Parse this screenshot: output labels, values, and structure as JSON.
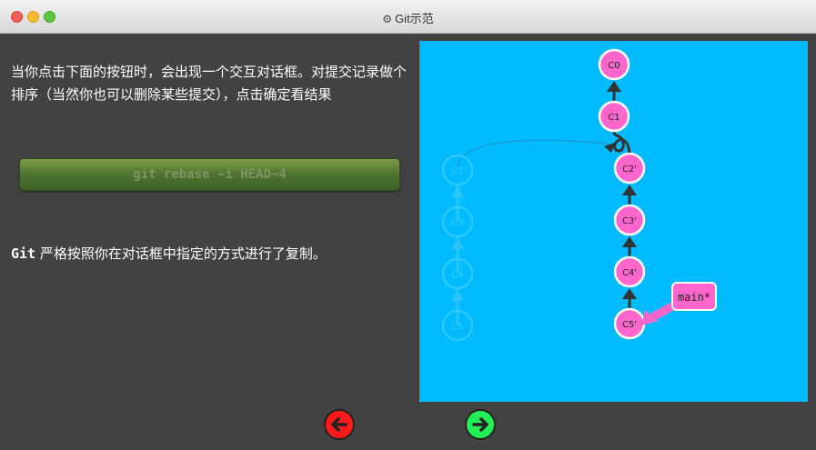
{
  "window": {
    "title": "Git示范"
  },
  "instructions": {
    "p1": "当你点击下面的按钮时，会出现一个交互对话框。对提交记录做个排序（当然你也可以删除某些提交），点击确定看结果",
    "p2_code": "Git",
    "p2_text": " 严格按照你在对话框中指定的方式进行了复制。"
  },
  "command_button": {
    "label": "git rebase -i HEAD~4"
  },
  "graph": {
    "ghost_commits": [
      "C2",
      "C3",
      "C4",
      "C5"
    ],
    "commits": [
      "C0",
      "C1",
      "C2'",
      "C3'",
      "C4'",
      "C5'"
    ],
    "branch": {
      "label": "main*"
    },
    "colors": {
      "background": "#00bbff",
      "commit_fill": "#ff66cc",
      "commit_stroke": "#ffffff",
      "ghost": "#33ccff",
      "arrow": "#333333",
      "branch_fill": "#ff66cc"
    }
  },
  "navigation": {
    "back": "left-arrow-icon",
    "forward": "right-arrow-icon"
  }
}
